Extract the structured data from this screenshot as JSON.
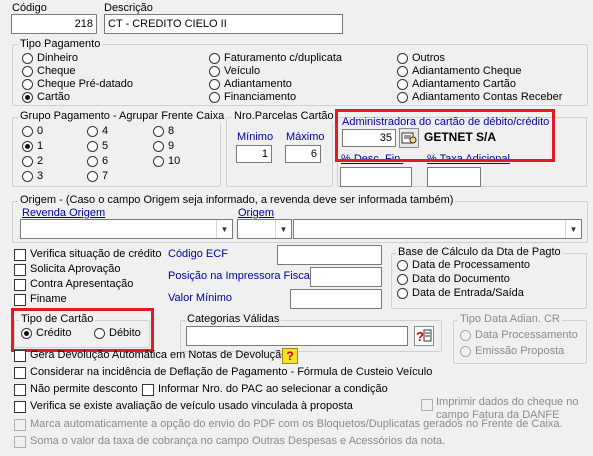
{
  "header": {
    "codigo_label": "Código",
    "codigo_value": "218",
    "descricao_label": "Descrição",
    "descricao_value": "CT - CREDITO CIELO II"
  },
  "tipo_pagamento": {
    "title": "Tipo Pagamento",
    "col1": [
      "Dinheiro",
      "Cheque",
      "Cheque Pré-datado",
      "Cartão"
    ],
    "col2": [
      "Faturamento c/duplicata",
      "Veículo",
      "Adiantamento",
      "Financiamento"
    ],
    "col3": [
      "Outros",
      "Adiantamento Cheque",
      "Adiantamento Cartão",
      "Adiantamento Contas Receber"
    ],
    "selected": "Cartão"
  },
  "grupo_pagamento": {
    "title": "Grupo Pagamento - Agrupar Frente Caixa",
    "options": [
      "0",
      "1",
      "2",
      "3",
      "4",
      "5",
      "6",
      "7",
      "8",
      "9",
      "10"
    ],
    "selected": "1"
  },
  "parcelas": {
    "title": "Nro.Parcelas Cartão",
    "minimo_label": "Mínimo",
    "minimo_value": "1",
    "maximo_label": "Máximo",
    "maximo_value": "6"
  },
  "administradora": {
    "title": "Administradora do cartão de débito/crédito",
    "code": "35",
    "name": "GETNET S/A",
    "desc_fin_label": "% Desc. Fin.",
    "taxa_label": "% Taxa Adicional"
  },
  "origem": {
    "title": "Origem - (Caso o campo Origem seja informado, a revenda deve ser informada também)",
    "revenda_label": "Revenda Origem",
    "origem_label": "Origem"
  },
  "checks_left": {
    "verifica_credito": "Verifica situação de crédito",
    "solicita_aprovacao": "Solicita Aprovação",
    "contra_apresentacao": "Contra Apresentação",
    "finame": "Finame"
  },
  "ecf": {
    "codigo_label": "Código ECF",
    "posicao_label": "Posição na Impressora Fiscal",
    "valor_minimo_label": "Valor Mínimo"
  },
  "base_calculo": {
    "title": "Base de Cálculo da Dta de Pagto",
    "options": [
      "Data de Processamento",
      "Data do Documento",
      "Data de Entrada/Saída"
    ]
  },
  "tipo_cartao": {
    "title": "Tipo de Cartão",
    "credito": "Crédito",
    "debito": "Débito",
    "selected": "Crédito"
  },
  "categorias": {
    "title": "Categorias Válidas"
  },
  "tipo_data_adian": {
    "title": "Tipo Data Adian. CR",
    "options": [
      "Data Processamento",
      "Emissão Proposta"
    ]
  },
  "bottom_checks": {
    "gera_devolucao": "Gera Devolução Automática em Notas de Devolução",
    "considerar_deflacao": "Considerar na incidência de Deflação de Pagamento - Fórmula de Custeio Veículo",
    "nao_permite_desconto": "Não permite desconto",
    "informar_pac": "Informar Nro. do PAC ao selecionar a condição",
    "verifica_avaliacao": "Verifica se existe avaliação de veículo usado vinculada à proposta",
    "imprimir_cheque": "Imprimir dados do cheque no campo Fatura da DANFE",
    "marca_pdf": "Marca automaticamente a opção do envio do PDF com os Bloquetos/Duplicatas gerados no Frente de Caixa.",
    "soma_taxa": "Soma o valor da taxa de cobrança no campo Outras Despesas e Acessórios da nota."
  },
  "icons": {
    "question": "question-icon",
    "search": "search-icon"
  },
  "colors": {
    "highlight_red": "#e01b24",
    "label_blue": "#0000a0",
    "help_yellow": "#f5e02a"
  }
}
